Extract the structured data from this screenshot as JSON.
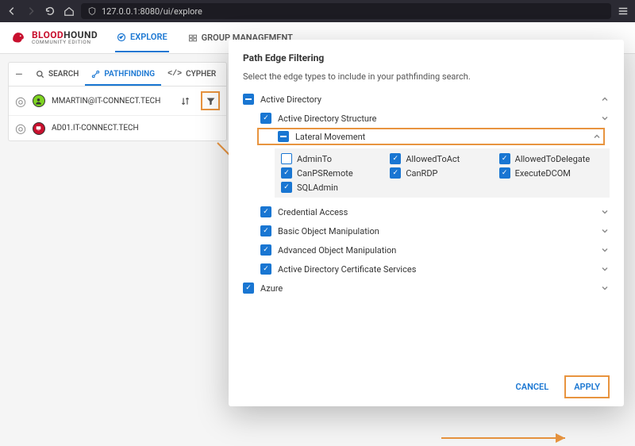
{
  "browser": {
    "url": "127.0.0.1:8080/ui/explore"
  },
  "logo": {
    "brand_a": "BLOOD",
    "brand_b": "HOUND",
    "sub": "COMMUNITY EDITION"
  },
  "header_tabs": {
    "explore": "EXPLORE",
    "group": "GROUP MANAGEMENT"
  },
  "pf_tabs": {
    "search": "SEARCH",
    "pathfinding": "PATHFINDING",
    "cypher": "CYPHER"
  },
  "query": {
    "start": "MMARTIN@IT-CONNECT.TECH",
    "end": "AD01.IT-CONNECT.TECH"
  },
  "modal": {
    "title": "Path Edge Filtering",
    "desc": "Select the edge types to include in your pathfinding search.",
    "cancel": "CANCEL",
    "apply": "APPLY",
    "groups": {
      "ad": "Active Directory",
      "ad_struct": "Active Directory Structure",
      "lateral": "Lateral Movement",
      "cred": "Credential Access",
      "basic": "Basic Object Manipulation",
      "adv": "Advanced Object Manipulation",
      "adcs": "Active Directory Certificate Services",
      "azure": "Azure"
    },
    "edges": [
      {
        "label": "AdminTo",
        "checked": false
      },
      {
        "label": "AllowedToAct",
        "checked": true
      },
      {
        "label": "AllowedToDelegate",
        "checked": true
      },
      {
        "label": "CanPSRemote",
        "checked": true
      },
      {
        "label": "CanRDP",
        "checked": true
      },
      {
        "label": "ExecuteDCOM",
        "checked": true
      },
      {
        "label": "SQLAdmin",
        "checked": true
      }
    ]
  }
}
